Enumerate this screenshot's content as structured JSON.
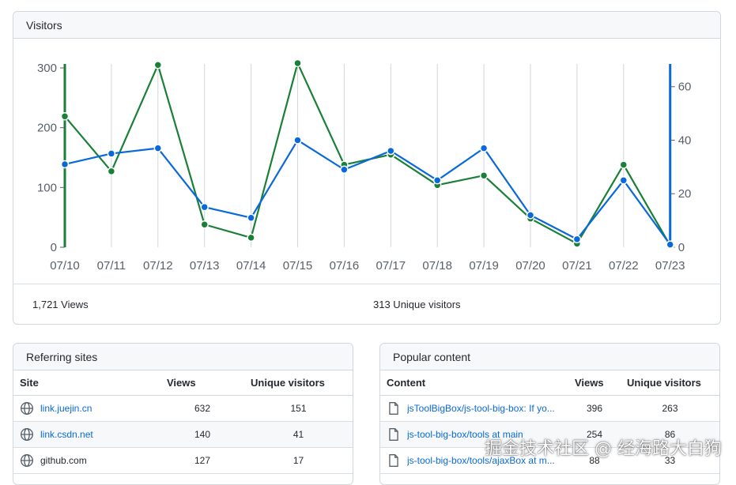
{
  "visitors": {
    "title": "Visitors",
    "views_total": "1,721 Views",
    "unique_total": "313 Unique visitors"
  },
  "chart_data": {
    "type": "line",
    "categories": [
      "07/10",
      "07/11",
      "07/12",
      "07/13",
      "07/14",
      "07/15",
      "07/16",
      "07/17",
      "07/18",
      "07/19",
      "07/20",
      "07/21",
      "07/22",
      "07/23"
    ],
    "series": [
      {
        "axis": "left",
        "color": "#1a7f37",
        "values": [
          219,
          127,
          305,
          38,
          16,
          308,
          138,
          155,
          104,
          120,
          48,
          6,
          138,
          3
        ]
      },
      {
        "axis": "right",
        "color": "#0969da",
        "values": [
          31,
          35,
          37,
          15,
          11,
          40,
          29,
          36,
          25,
          37,
          12,
          3,
          25,
          1
        ]
      }
    ],
    "left_axis": {
      "ticks": [
        0,
        100,
        200,
        300
      ],
      "ylim": [
        0,
        300
      ]
    },
    "right_axis": {
      "ticks": [
        0,
        20,
        40,
        60
      ],
      "ylim": [
        0,
        67
      ]
    },
    "grid": "vertical"
  },
  "referring": {
    "title": "Referring sites",
    "headers": {
      "site": "Site",
      "views": "Views",
      "unique": "Unique visitors"
    },
    "rows": [
      {
        "site": "link.juejin.cn",
        "views": "632",
        "unique": "151",
        "icon": "globe-icon"
      },
      {
        "site": "link.csdn.net",
        "views": "140",
        "unique": "41",
        "icon": "globe-icon"
      },
      {
        "site": "github.com",
        "views": "127",
        "unique": "17",
        "icon": "globe-icon"
      }
    ]
  },
  "popular": {
    "title": "Popular content",
    "headers": {
      "content": "Content",
      "views": "Views",
      "unique": "Unique visitors"
    },
    "rows": [
      {
        "content": "jsToolBigBox/js-tool-big-box: If yo...",
        "views": "396",
        "unique": "263",
        "icon": "file-icon"
      },
      {
        "content": "js-tool-big-box/tools at main",
        "views": "254",
        "unique": "86",
        "icon": "file-icon"
      },
      {
        "content": "js-tool-big-box/tools/ajaxBox at m...",
        "views": "88",
        "unique": "33",
        "icon": "file-icon"
      }
    ]
  },
  "watermark": "掘金技术社区 @ 经海路大白狗"
}
